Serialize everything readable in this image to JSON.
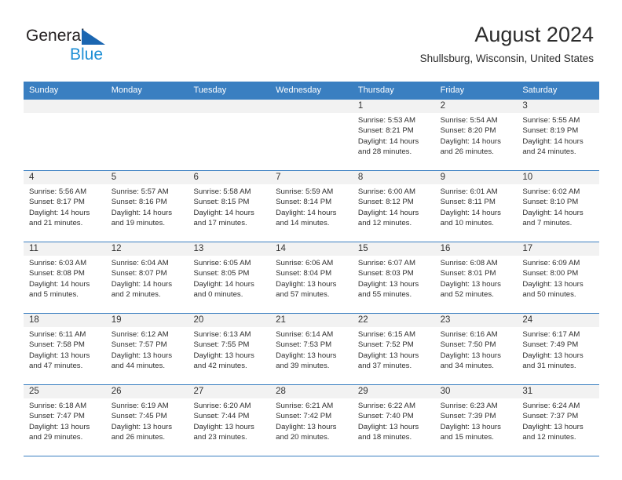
{
  "brand": {
    "name_top": "General",
    "name_bottom": "Blue",
    "triangle_color": "#1b66b1",
    "blue_text_color": "#1e8fd5"
  },
  "header": {
    "month_title": "August 2024",
    "location": "Shullsburg, Wisconsin, United States"
  },
  "theme": {
    "header_blue": "#3a7fc1",
    "day_number_bg": "#f2f2f2",
    "text_color": "#2f2f2f"
  },
  "weekdays": [
    "Sunday",
    "Monday",
    "Tuesday",
    "Wednesday",
    "Thursday",
    "Friday",
    "Saturday"
  ],
  "weeks": [
    [
      {
        "day": "",
        "sunrise": "",
        "sunset": "",
        "daylight_line1": "",
        "daylight_line2": ""
      },
      {
        "day": "",
        "sunrise": "",
        "sunset": "",
        "daylight_line1": "",
        "daylight_line2": ""
      },
      {
        "day": "",
        "sunrise": "",
        "sunset": "",
        "daylight_line1": "",
        "daylight_line2": ""
      },
      {
        "day": "",
        "sunrise": "",
        "sunset": "",
        "daylight_line1": "",
        "daylight_line2": ""
      },
      {
        "day": "1",
        "sunrise": "Sunrise: 5:53 AM",
        "sunset": "Sunset: 8:21 PM",
        "daylight_line1": "Daylight: 14 hours",
        "daylight_line2": "and 28 minutes."
      },
      {
        "day": "2",
        "sunrise": "Sunrise: 5:54 AM",
        "sunset": "Sunset: 8:20 PM",
        "daylight_line1": "Daylight: 14 hours",
        "daylight_line2": "and 26 minutes."
      },
      {
        "day": "3",
        "sunrise": "Sunrise: 5:55 AM",
        "sunset": "Sunset: 8:19 PM",
        "daylight_line1": "Daylight: 14 hours",
        "daylight_line2": "and 24 minutes."
      }
    ],
    [
      {
        "day": "4",
        "sunrise": "Sunrise: 5:56 AM",
        "sunset": "Sunset: 8:17 PM",
        "daylight_line1": "Daylight: 14 hours",
        "daylight_line2": "and 21 minutes."
      },
      {
        "day": "5",
        "sunrise": "Sunrise: 5:57 AM",
        "sunset": "Sunset: 8:16 PM",
        "daylight_line1": "Daylight: 14 hours",
        "daylight_line2": "and 19 minutes."
      },
      {
        "day": "6",
        "sunrise": "Sunrise: 5:58 AM",
        "sunset": "Sunset: 8:15 PM",
        "daylight_line1": "Daylight: 14 hours",
        "daylight_line2": "and 17 minutes."
      },
      {
        "day": "7",
        "sunrise": "Sunrise: 5:59 AM",
        "sunset": "Sunset: 8:14 PM",
        "daylight_line1": "Daylight: 14 hours",
        "daylight_line2": "and 14 minutes."
      },
      {
        "day": "8",
        "sunrise": "Sunrise: 6:00 AM",
        "sunset": "Sunset: 8:12 PM",
        "daylight_line1": "Daylight: 14 hours",
        "daylight_line2": "and 12 minutes."
      },
      {
        "day": "9",
        "sunrise": "Sunrise: 6:01 AM",
        "sunset": "Sunset: 8:11 PM",
        "daylight_line1": "Daylight: 14 hours",
        "daylight_line2": "and 10 minutes."
      },
      {
        "day": "10",
        "sunrise": "Sunrise: 6:02 AM",
        "sunset": "Sunset: 8:10 PM",
        "daylight_line1": "Daylight: 14 hours",
        "daylight_line2": "and 7 minutes."
      }
    ],
    [
      {
        "day": "11",
        "sunrise": "Sunrise: 6:03 AM",
        "sunset": "Sunset: 8:08 PM",
        "daylight_line1": "Daylight: 14 hours",
        "daylight_line2": "and 5 minutes."
      },
      {
        "day": "12",
        "sunrise": "Sunrise: 6:04 AM",
        "sunset": "Sunset: 8:07 PM",
        "daylight_line1": "Daylight: 14 hours",
        "daylight_line2": "and 2 minutes."
      },
      {
        "day": "13",
        "sunrise": "Sunrise: 6:05 AM",
        "sunset": "Sunset: 8:05 PM",
        "daylight_line1": "Daylight: 14 hours",
        "daylight_line2": "and 0 minutes."
      },
      {
        "day": "14",
        "sunrise": "Sunrise: 6:06 AM",
        "sunset": "Sunset: 8:04 PM",
        "daylight_line1": "Daylight: 13 hours",
        "daylight_line2": "and 57 minutes."
      },
      {
        "day": "15",
        "sunrise": "Sunrise: 6:07 AM",
        "sunset": "Sunset: 8:03 PM",
        "daylight_line1": "Daylight: 13 hours",
        "daylight_line2": "and 55 minutes."
      },
      {
        "day": "16",
        "sunrise": "Sunrise: 6:08 AM",
        "sunset": "Sunset: 8:01 PM",
        "daylight_line1": "Daylight: 13 hours",
        "daylight_line2": "and 52 minutes."
      },
      {
        "day": "17",
        "sunrise": "Sunrise: 6:09 AM",
        "sunset": "Sunset: 8:00 PM",
        "daylight_line1": "Daylight: 13 hours",
        "daylight_line2": "and 50 minutes."
      }
    ],
    [
      {
        "day": "18",
        "sunrise": "Sunrise: 6:11 AM",
        "sunset": "Sunset: 7:58 PM",
        "daylight_line1": "Daylight: 13 hours",
        "daylight_line2": "and 47 minutes."
      },
      {
        "day": "19",
        "sunrise": "Sunrise: 6:12 AM",
        "sunset": "Sunset: 7:57 PM",
        "daylight_line1": "Daylight: 13 hours",
        "daylight_line2": "and 44 minutes."
      },
      {
        "day": "20",
        "sunrise": "Sunrise: 6:13 AM",
        "sunset": "Sunset: 7:55 PM",
        "daylight_line1": "Daylight: 13 hours",
        "daylight_line2": "and 42 minutes."
      },
      {
        "day": "21",
        "sunrise": "Sunrise: 6:14 AM",
        "sunset": "Sunset: 7:53 PM",
        "daylight_line1": "Daylight: 13 hours",
        "daylight_line2": "and 39 minutes."
      },
      {
        "day": "22",
        "sunrise": "Sunrise: 6:15 AM",
        "sunset": "Sunset: 7:52 PM",
        "daylight_line1": "Daylight: 13 hours",
        "daylight_line2": "and 37 minutes."
      },
      {
        "day": "23",
        "sunrise": "Sunrise: 6:16 AM",
        "sunset": "Sunset: 7:50 PM",
        "daylight_line1": "Daylight: 13 hours",
        "daylight_line2": "and 34 minutes."
      },
      {
        "day": "24",
        "sunrise": "Sunrise: 6:17 AM",
        "sunset": "Sunset: 7:49 PM",
        "daylight_line1": "Daylight: 13 hours",
        "daylight_line2": "and 31 minutes."
      }
    ],
    [
      {
        "day": "25",
        "sunrise": "Sunrise: 6:18 AM",
        "sunset": "Sunset: 7:47 PM",
        "daylight_line1": "Daylight: 13 hours",
        "daylight_line2": "and 29 minutes."
      },
      {
        "day": "26",
        "sunrise": "Sunrise: 6:19 AM",
        "sunset": "Sunset: 7:45 PM",
        "daylight_line1": "Daylight: 13 hours",
        "daylight_line2": "and 26 minutes."
      },
      {
        "day": "27",
        "sunrise": "Sunrise: 6:20 AM",
        "sunset": "Sunset: 7:44 PM",
        "daylight_line1": "Daylight: 13 hours",
        "daylight_line2": "and 23 minutes."
      },
      {
        "day": "28",
        "sunrise": "Sunrise: 6:21 AM",
        "sunset": "Sunset: 7:42 PM",
        "daylight_line1": "Daylight: 13 hours",
        "daylight_line2": "and 20 minutes."
      },
      {
        "day": "29",
        "sunrise": "Sunrise: 6:22 AM",
        "sunset": "Sunset: 7:40 PM",
        "daylight_line1": "Daylight: 13 hours",
        "daylight_line2": "and 18 minutes."
      },
      {
        "day": "30",
        "sunrise": "Sunrise: 6:23 AM",
        "sunset": "Sunset: 7:39 PM",
        "daylight_line1": "Daylight: 13 hours",
        "daylight_line2": "and 15 minutes."
      },
      {
        "day": "31",
        "sunrise": "Sunrise: 6:24 AM",
        "sunset": "Sunset: 7:37 PM",
        "daylight_line1": "Daylight: 13 hours",
        "daylight_line2": "and 12 minutes."
      }
    ]
  ]
}
